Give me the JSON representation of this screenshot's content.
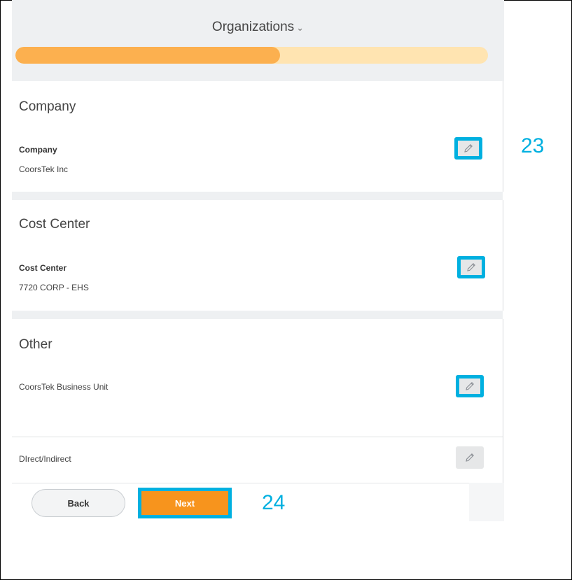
{
  "header": {
    "title": "Organizations",
    "progress_fraction": 0.56
  },
  "sections": [
    {
      "title": "Company",
      "field_label": "Company",
      "field_value": "CoorsTek Inc"
    },
    {
      "title": "Cost Center",
      "field_label": "Cost Center",
      "field_value": "7720 CORP - EHS"
    },
    {
      "title": "Other",
      "fields": [
        "CoorsTek Business Unit",
        "DIrect/Indirect"
      ]
    }
  ],
  "footer": {
    "back_label": "Back",
    "next_label": "Next"
  },
  "callouts": {
    "edit_step": "23",
    "next_step": "24"
  },
  "colors": {
    "accent": "#00b0e0",
    "next": "#f7941d",
    "progress": "#fcb04f",
    "progress_track": "#ffe4b1"
  },
  "icons": {
    "edit": "pencil-icon",
    "chevron": "chevron-down-icon"
  }
}
